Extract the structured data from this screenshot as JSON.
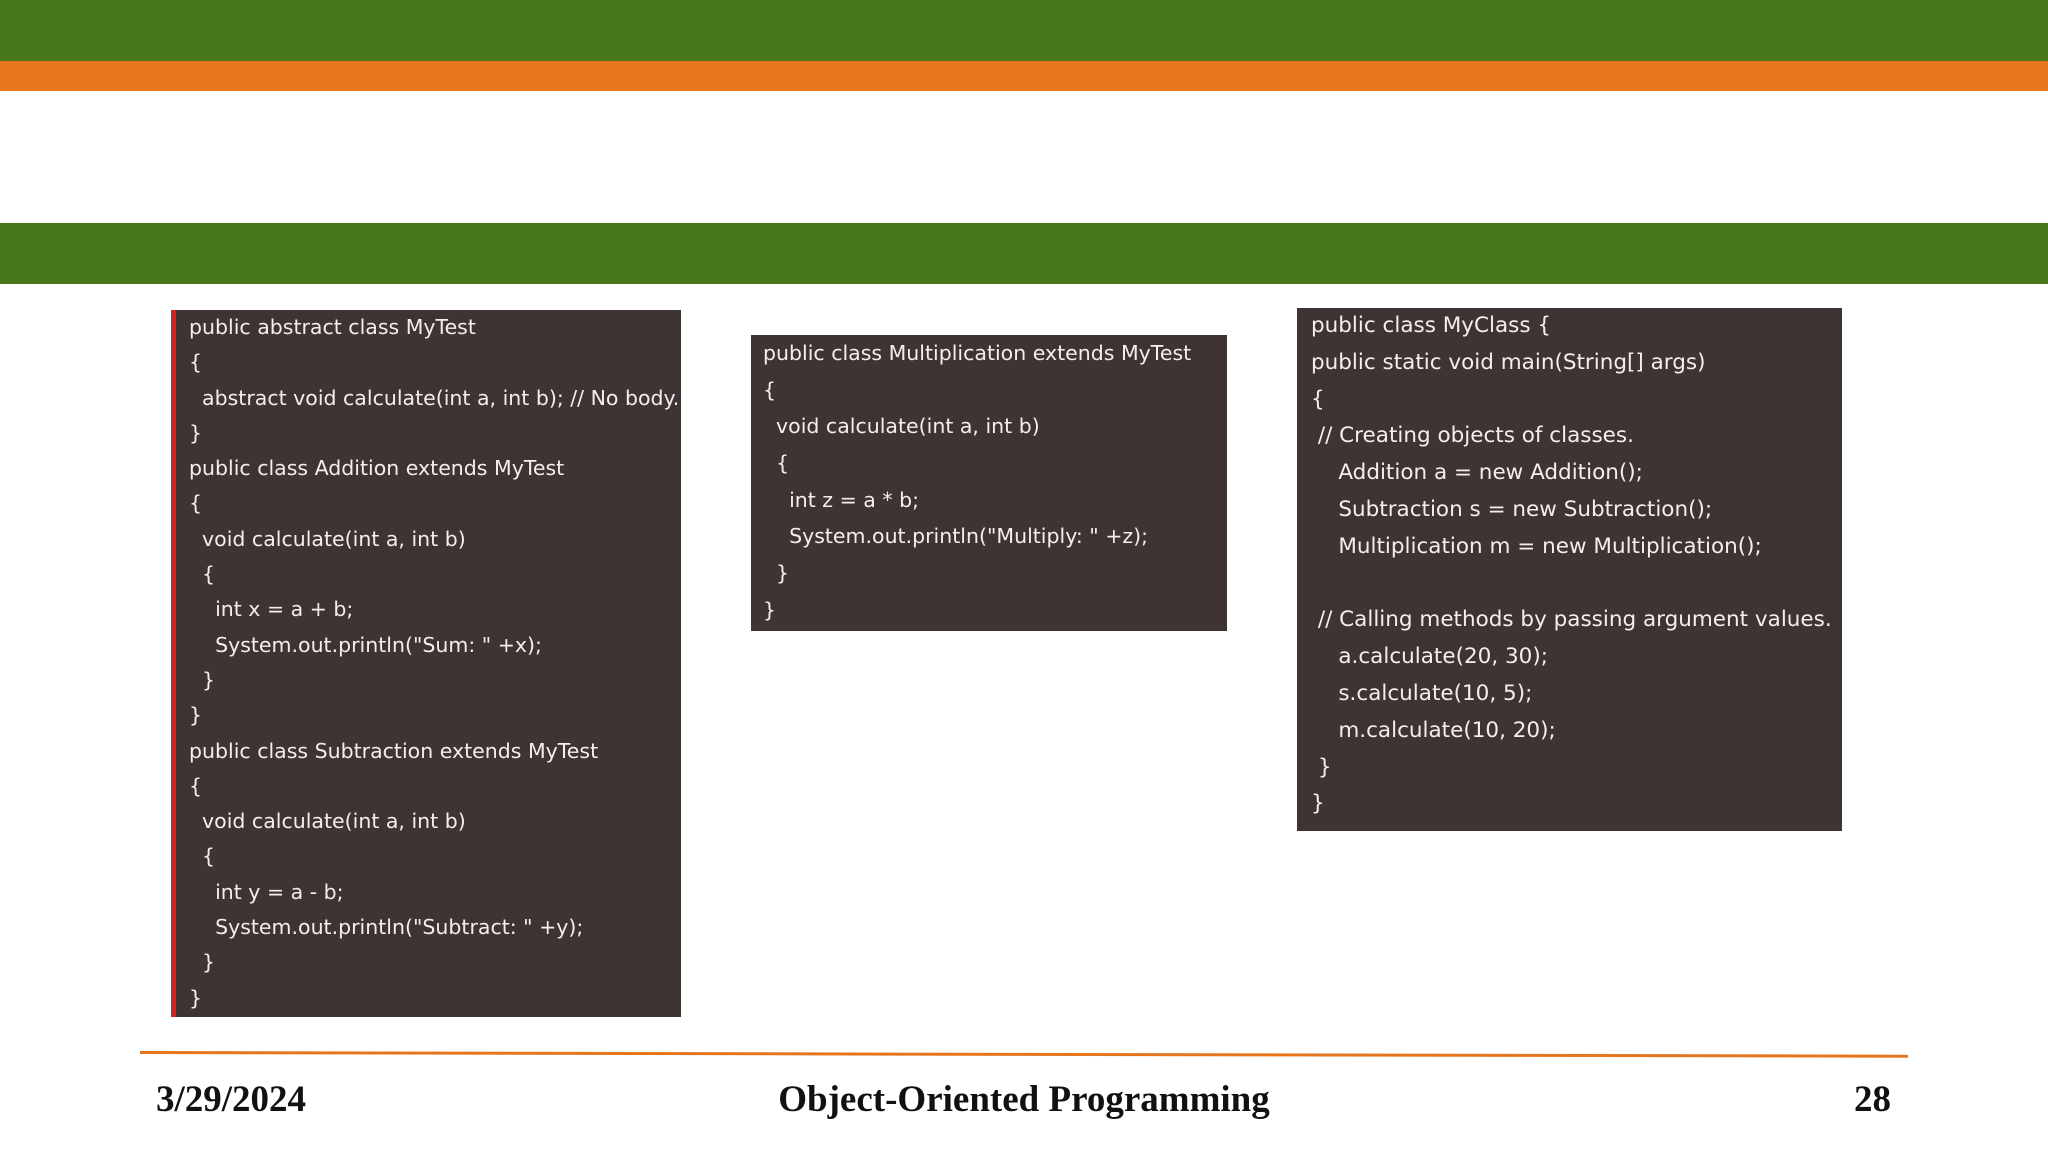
{
  "colors": {
    "band_green": "#47761c",
    "band_orange": "#e6761e",
    "code_background": "#3f3434",
    "code_text": "#f2efee",
    "accent_border": "#d32222"
  },
  "panels": {
    "abstract_classes": {
      "lines": [
        "public abstract class MyTest",
        "{",
        "  abstract void calculate(int a, int b); // No body.",
        "}",
        "public class Addition extends MyTest",
        "{",
        "  void calculate(int a, int b)",
        "  {",
        "    int x = a + b;",
        "    System.out.println(\"Sum: \" +x);",
        "  }",
        "}",
        "public class Subtraction extends MyTest",
        "{",
        "  void calculate(int a, int b)",
        "  {",
        "    int y = a - b;",
        "    System.out.println(\"Subtract: \" +y);",
        "  }",
        "}"
      ]
    },
    "multiplication_class": {
      "lines": [
        "public class Multiplication extends MyTest",
        "{",
        "  void calculate(int a, int b)",
        "  {",
        "    int z = a * b;",
        "    System.out.println(\"Multiply: \" +z);",
        "  }",
        "}"
      ]
    },
    "main_class": {
      "lines": [
        "public class MyClass {",
        "public static void main(String[] args)",
        "{",
        " // Creating objects of classes.",
        "    Addition a = new Addition();",
        "    Subtraction s = new Subtraction();",
        "    Multiplication m = new Multiplication();",
        "",
        " // Calling methods by passing argument values.",
        "    a.calculate(20, 30);",
        "    s.calculate(10, 5);",
        "    m.calculate(10, 20);",
        " }",
        "}"
      ]
    }
  },
  "footer": {
    "date": "3/29/2024",
    "title": "Object-Oriented Programming",
    "page_number": "28"
  }
}
